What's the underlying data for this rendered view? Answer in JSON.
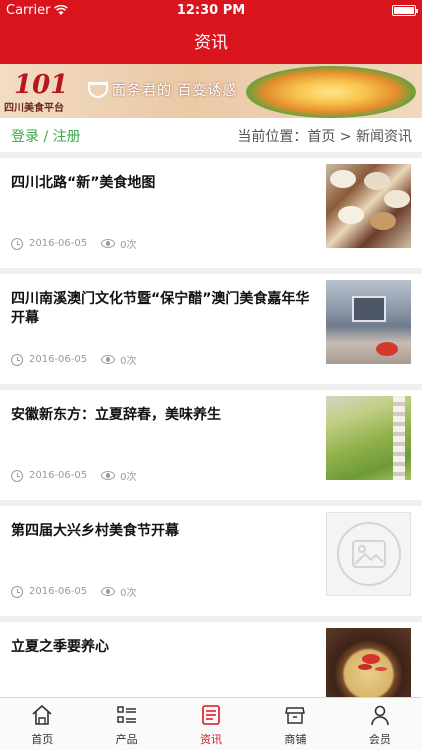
{
  "status_bar": {
    "carrier": "Carrier",
    "time": "12:30 PM"
  },
  "nav": {
    "title": "资讯"
  },
  "banner": {
    "logo_text": "四川美食平台",
    "slogan": "面条君的 百变诱惑"
  },
  "breadcrumb": {
    "login_label": "登录 / 注册",
    "location_label": "当前位置：首页 > 新闻资讯"
  },
  "news": [
    {
      "title": "四川北路“新”美食地图",
      "date": "2016-06-05",
      "views": "0次",
      "thumb": "food-platter"
    },
    {
      "title": "四川南溪澳门文化节暨“保宁醋”澳门美食嘉年华开幕",
      "date": "2016-06-05",
      "views": "0次",
      "thumb": "plaza"
    },
    {
      "title": "安徽新东方：立夏辞春，美味养生",
      "date": "2016-06-05",
      "views": "0次",
      "thumb": "field"
    },
    {
      "title": "第四届大兴乡村美食节开幕",
      "date": "2016-06-05",
      "views": "0次",
      "thumb": "image-placeholder"
    },
    {
      "title": "立夏之季要养心",
      "date": "2016-06-05",
      "views": "0次",
      "thumb": "soup"
    }
  ],
  "tabs": [
    {
      "label": "首页",
      "icon": "home-icon"
    },
    {
      "label": "产品",
      "icon": "list-icon"
    },
    {
      "label": "资讯",
      "icon": "news-icon",
      "active": true
    },
    {
      "label": "商铺",
      "icon": "shop-icon"
    },
    {
      "label": "会员",
      "icon": "user-icon"
    }
  ],
  "colors": {
    "brand_red": "#d9141d",
    "login_green": "#3aa84a"
  }
}
